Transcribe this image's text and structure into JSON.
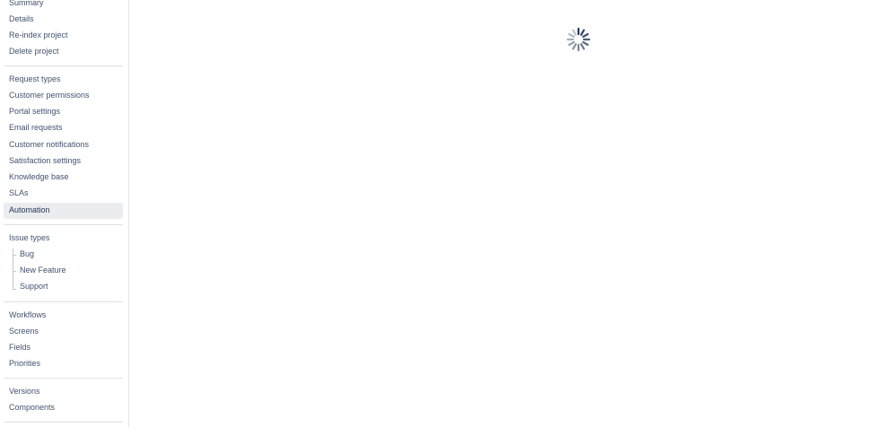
{
  "sidebar": {
    "project": [
      "Summary",
      "Details",
      "Re-index project",
      "Delete project"
    ],
    "service": [
      "Request types",
      "Customer permissions",
      "Portal settings",
      "Email requests",
      "Customer notifications",
      "Satisfaction settings",
      "Knowledge base",
      "SLAs",
      "Automation"
    ],
    "issue_types": {
      "label": "Issue types",
      "children": [
        "Bug",
        "New Feature",
        "Support"
      ]
    },
    "config": [
      "Workflows",
      "Screens",
      "Fields",
      "Priorities"
    ],
    "release": [
      "Versions",
      "Components"
    ],
    "selected": "Automation"
  },
  "main": {
    "loading_icon": "loading-spinner-icon"
  }
}
